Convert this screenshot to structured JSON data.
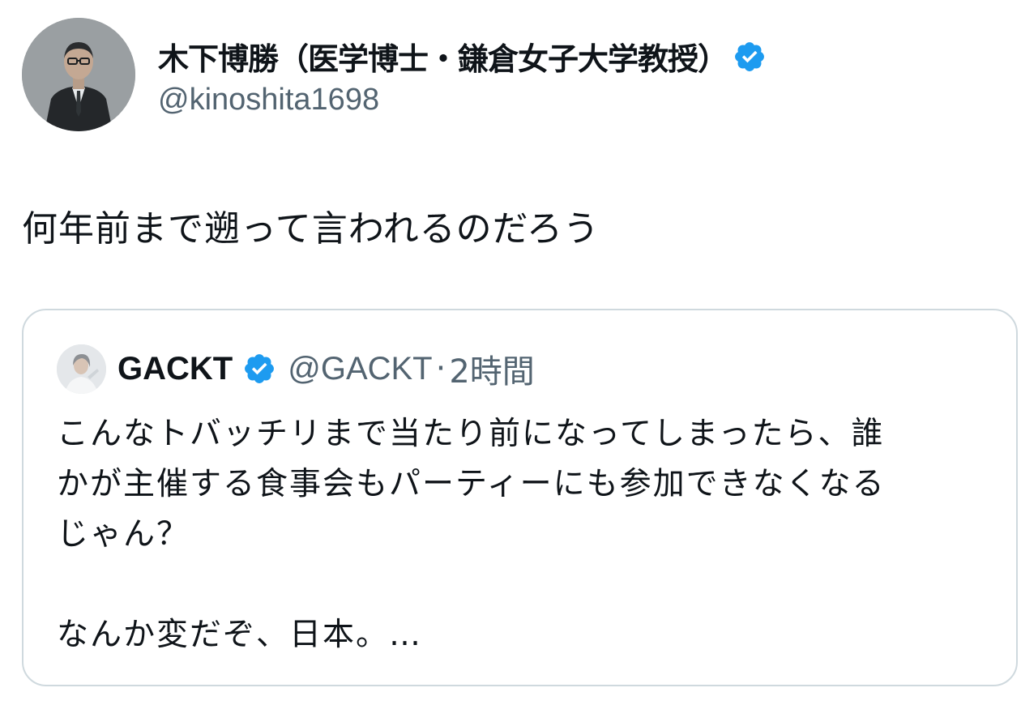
{
  "colors": {
    "verified_badge": "#1d9bf0",
    "handle_text": "#536471",
    "card_border": "#cfd9de"
  },
  "tweet": {
    "author": {
      "display_name": "木下博勝（医学博士・鎌倉女子大学教授）",
      "handle": "@kinoshita1698",
      "avatar_icon": "profile-photo",
      "verified_icon": "verified-badge-icon"
    },
    "text": "何年前まで遡って言われるのだろう"
  },
  "quoted_tweet": {
    "author": {
      "display_name": "GACKT",
      "handle": "@GACKT",
      "verified_icon": "verified-badge-icon"
    },
    "separator": "·",
    "timestamp": "2時間",
    "lines": [
      "こんなトバッチリまで当たり前になってしまったら、誰",
      "かが主催する食事会もパーティーにも参加できなくなる",
      "じゃん？",
      "",
      "なんか変だぞ、日本。…"
    ]
  }
}
